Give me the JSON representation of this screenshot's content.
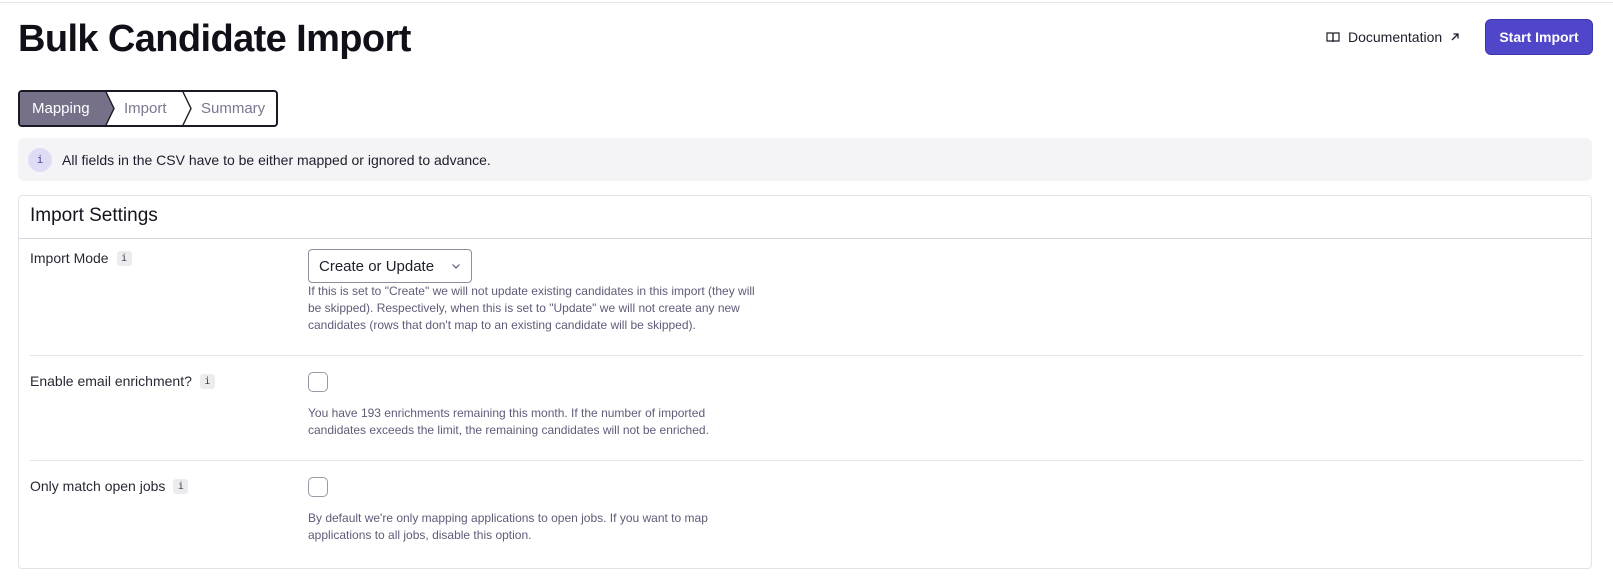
{
  "header": {
    "title": "Bulk Candidate Import",
    "documentation_label": "Documentation",
    "start_button_label": "Start Import"
  },
  "stepper": {
    "steps": [
      {
        "label": "Mapping",
        "active": true
      },
      {
        "label": "Import",
        "active": false
      },
      {
        "label": "Summary",
        "active": false
      }
    ]
  },
  "info_banner": {
    "icon": "i",
    "text": "All fields in the CSV have to be either mapped or ignored to advance."
  },
  "settings": {
    "title": "Import Settings",
    "info_icon": "i",
    "import_mode": {
      "label": "Import Mode",
      "selected": "Create or Update",
      "help_lines": [
        "If this is set to \"Create\" we will not update existing candidates in this import (they will",
        "be skipped). Respectively, when this is set to \"Update\" we will not create any new",
        "candidates (rows that don't map to an existing candidate will be skipped)."
      ]
    },
    "email_enrichment": {
      "label": "Enable email enrichment?",
      "checked": false,
      "help_lines": [
        "You have 193 enrichments remaining this month. If the number of imported",
        "candidates exceeds the limit, the remaining candidates will not be enriched."
      ]
    },
    "open_jobs": {
      "label": "Only match open jobs",
      "checked": false,
      "help_lines": [
        "By default we're only mapping applications to open jobs. If you want to map",
        "applications to all jobs, disable this option."
      ]
    }
  },
  "colors": {
    "primary": "#5046c9",
    "active_step": "#767189",
    "banner_bg": "#f4f4f7"
  }
}
